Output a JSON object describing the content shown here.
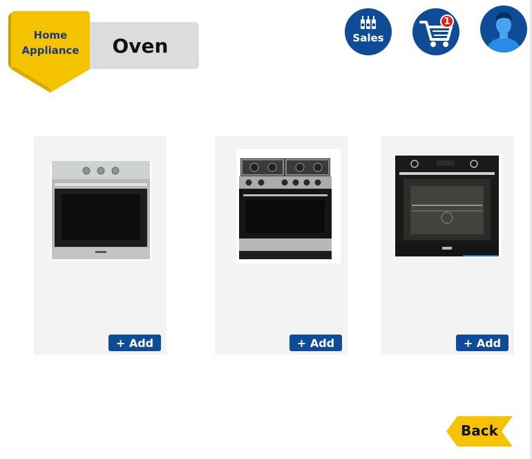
{
  "header": {
    "category_label_line1": "Home",
    "category_label_line2": "Appliance",
    "page_title": "Oven"
  },
  "top_nav": {
    "sales_label": "Sales",
    "cart_count": "1"
  },
  "products": [
    {
      "add_label": "+ Add"
    },
    {
      "add_label": "+ Add"
    },
    {
      "add_label": "+ Add"
    }
  ],
  "back_label": "Back",
  "colors": {
    "brand_blue": "#0f4c97",
    "ribbon_yellow": "#f6c300",
    "badge_red": "#e2231a",
    "card_bg": "#f3f3f3"
  }
}
